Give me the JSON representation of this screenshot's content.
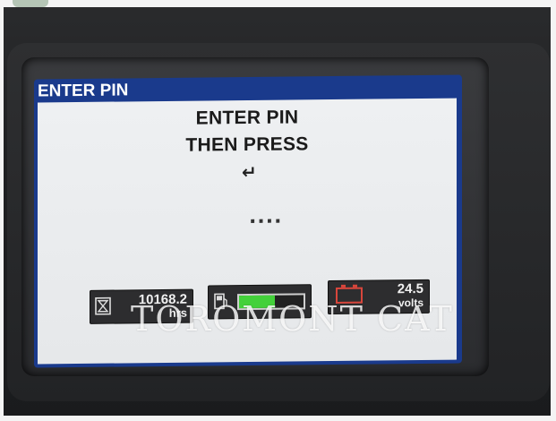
{
  "screen": {
    "title": "ENTER PIN",
    "prompt_line1": "ENTER PIN",
    "prompt_line2": "THEN PRESS",
    "enter_symbol": "↵",
    "pin_entry": "....",
    "accent_color": "#1a3a8c"
  },
  "status_bar": {
    "hours": {
      "icon": "hourglass-icon",
      "value": "10168.2",
      "unit": "hrs"
    },
    "fuel": {
      "icon": "fuel-pump-icon",
      "level": 0.55,
      "fill_color": "#43d13a"
    },
    "battery": {
      "icon": "battery-icon",
      "value": "24.5",
      "unit": "volts",
      "icon_color": "#d8463c"
    }
  },
  "watermark": "TOROMONT CAT"
}
